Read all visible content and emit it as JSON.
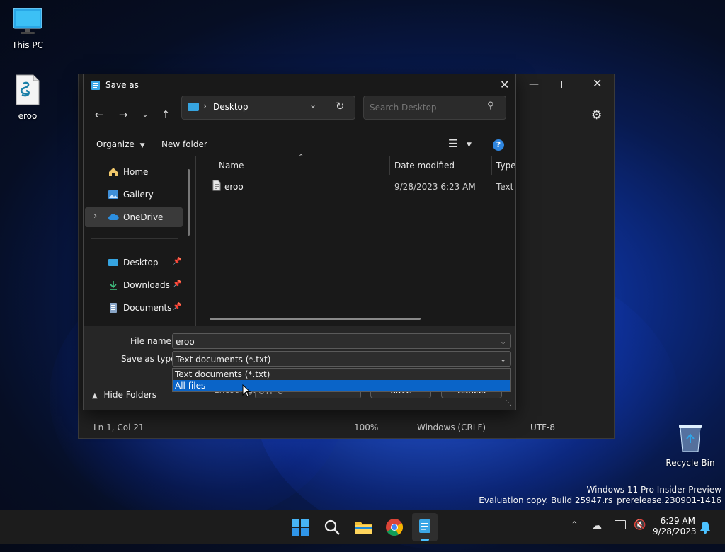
{
  "desktop": {
    "icons": [
      {
        "label": "This PC"
      },
      {
        "label": "eroo"
      },
      {
        "label": "Recycle Bin"
      }
    ],
    "watermark": {
      "line1": "Windows 11 Pro Insider Preview",
      "line2": "Evaluation copy. Build 25947.rs_prerelease.230901-1416"
    }
  },
  "notepad": {
    "status": {
      "position": "Ln 1, Col 21",
      "zoom": "100%",
      "line_ending": "Windows (CRLF)",
      "encoding": "UTF-8"
    }
  },
  "dialog": {
    "title": "Save as",
    "address": {
      "location": "Desktop"
    },
    "search": {
      "placeholder": "Search Desktop"
    },
    "toolbar": {
      "organize": "Organize",
      "new_folder": "New folder"
    },
    "nav": {
      "items": [
        {
          "label": "Home"
        },
        {
          "label": "Gallery"
        },
        {
          "label": "OneDrive"
        },
        {
          "label": "Desktop"
        },
        {
          "label": "Downloads"
        },
        {
          "label": "Documents"
        }
      ]
    },
    "columns": {
      "name": "Name",
      "date": "Date modified",
      "type": "Type"
    },
    "files": [
      {
        "name": "eroo",
        "date": "9/28/2023 6:23 AM",
        "type": "Text D"
      }
    ],
    "form": {
      "filename_label": "File name:",
      "filename_value": "eroo",
      "type_label": "Save as type:",
      "type_value": "Text documents (*.txt)",
      "type_options": [
        "Text documents (*.txt)",
        "All files"
      ],
      "encoding_label": "Encoding:",
      "encoding_value": "UTF-8",
      "save": "Save",
      "cancel": "Cancel",
      "hide_folders": "Hide Folders"
    }
  },
  "taskbar": {
    "time": "6:29 AM",
    "date": "9/28/2023",
    "apps": [
      "start-icon",
      "search-icon",
      "file-explorer-icon",
      "chrome-icon",
      "notepad-icon"
    ]
  },
  "colors": {
    "accent": "#0067c0",
    "highlight": "#0a64c8"
  }
}
